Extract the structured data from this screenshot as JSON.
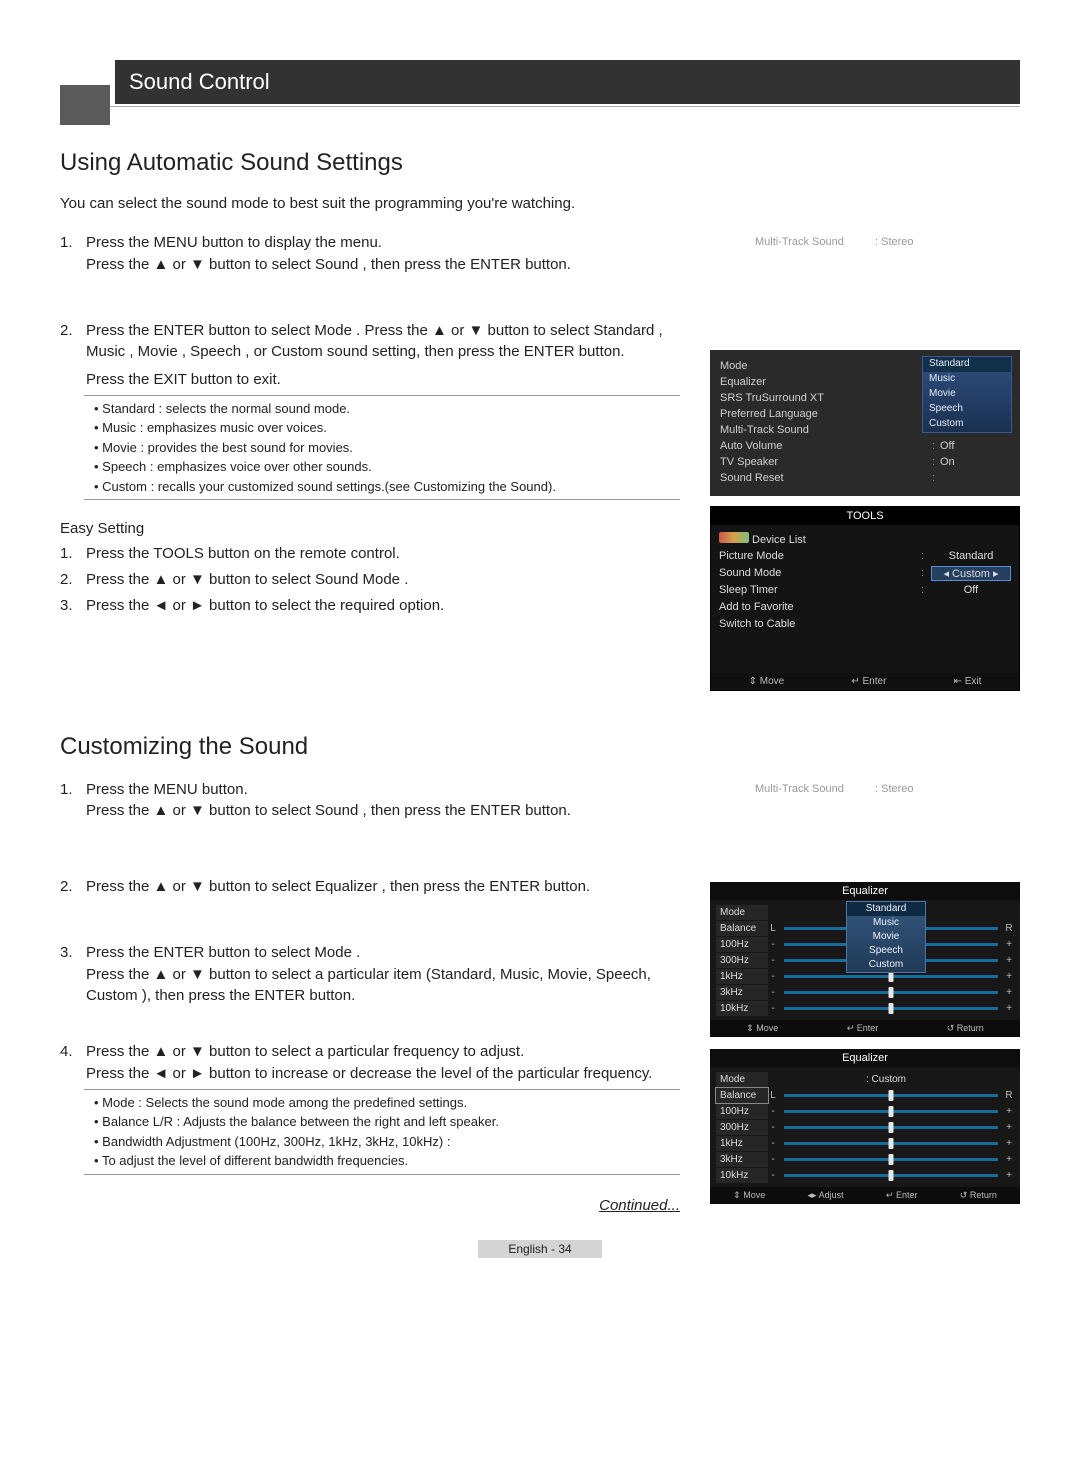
{
  "titlebar": "Sound Control",
  "section1": {
    "heading": "Using Automatic Sound Settings",
    "intro": "You can select the sound mode to best suit the programming you're watching.",
    "step1a": "Press the MENU button to display the menu.",
    "step1b": "Press the ▲ or ▼ button to select Sound , then press the ENTER    button.",
    "step2a": "Press the ENTER    button to select Mode . Press the ▲ or ▼ button to select Standard , Music , Movie , Speech , or Custom  sound setting, then press the ENTER    button.",
    "step2b": "Press the EXIT button to exit.",
    "bullets": [
      "Standard  : selects the normal sound mode.",
      "Music  : emphasizes music over voices.",
      "Movie  : provides the best sound for movies.",
      "Speech  : emphasizes voice over other sounds.",
      "Custom  : recalls your customized sound settings.(see Customizing the Sound)."
    ],
    "easy_title": "Easy Setting",
    "easy1": "Press the TOOLS button on the remote control.",
    "easy2": "Press the ▲ or ▼ button to select Sound Mode .",
    "easy3": "Press the ◄ or ► button to select the required option."
  },
  "section2": {
    "heading": "Customizing the Sound",
    "s1a": "Press the MENU button.",
    "s1b": "Press the ▲ or ▼ button to select Sound , then press the ENTER    button.",
    "s2": "Press the ▲ or ▼ button to select Equalizer , then press the ENTER    button.",
    "s3a": "Press the ENTER    button to select Mode .",
    "s3b": "Press the ▲ or ▼ button to select a particular item (Standard, Music, Movie, Speech, Custom ), then press the ENTER    button.",
    "s4a": "Press the ▲ or ▼ button to select a particular frequency to adjust.",
    "s4b": "Press the ◄ or ► button to increase or decrease the level of the particular frequency.",
    "bullets": [
      "Mode : Selects the sound mode among the predefined settings.",
      "Balance L/R : Adjusts the balance between the right and left speaker.",
      "Bandwidth Adjustment (100Hz, 300Hz, 1kHz, 3kHz, 10kHz) :",
      "   To adjust the level of different bandwidth frequencies."
    ]
  },
  "continued": "Continued...",
  "footer": "English - 34",
  "mts": {
    "label": "Multi-Track Sound",
    "value": ": Stereo"
  },
  "osd_sound": {
    "rows": [
      {
        "label": "Mode",
        "value": ""
      },
      {
        "label": "Equalizer",
        "value": ""
      },
      {
        "label": "SRS TruSurround XT",
        "value": ""
      },
      {
        "label": "Preferred Language",
        "value": ""
      },
      {
        "label": "Multi-Track Sound",
        "value": ""
      },
      {
        "label": "Auto Volume",
        "value": "Off"
      },
      {
        "label": "TV Speaker",
        "value": "On"
      },
      {
        "label": "Sound Reset",
        "value": ""
      }
    ],
    "options": [
      "Standard",
      "Music",
      "Movie",
      "Speech",
      "Custom"
    ]
  },
  "tools_panel": {
    "title": "TOOLS",
    "rows": [
      {
        "label": "Device List",
        "value": "",
        "ml": true
      },
      {
        "label": "Picture Mode",
        "value": "Standard"
      },
      {
        "label": "Sound Mode",
        "value": "Custom",
        "sel": true
      },
      {
        "label": "Sleep Timer",
        "value": "Off"
      },
      {
        "label": "Add to Favorite",
        "value": ""
      },
      {
        "label": "Switch to Cable",
        "value": ""
      }
    ],
    "footer": [
      "⇕ Move",
      "↵ Enter",
      "⇤ Exit"
    ]
  },
  "eq_panel1": {
    "title": "Equalizer",
    "mode_value": "Standard",
    "rows": [
      {
        "label": "Mode",
        "mode": true
      },
      {
        "label": "Balance",
        "l": "L",
        "r": "R"
      },
      {
        "label": "100Hz",
        "l": "-",
        "r": "+"
      },
      {
        "label": "300Hz",
        "l": "-",
        "r": "+"
      },
      {
        "label": "1kHz",
        "l": "-",
        "r": "+"
      },
      {
        "label": "3kHz",
        "l": "-",
        "r": "+"
      },
      {
        "label": "10kHz",
        "l": "-",
        "r": "+"
      }
    ],
    "dropdown": [
      "Standard",
      "Music",
      "Movie",
      "Speech",
      "Custom"
    ],
    "footer": [
      "⇕ Move",
      "↵ Enter",
      "↺ Return"
    ]
  },
  "eq_panel2": {
    "title": "Equalizer",
    "mode_value": ": Custom",
    "rows": [
      {
        "label": "Mode",
        "mode": true
      },
      {
        "label": "Balance",
        "l": "L",
        "r": "R",
        "hl": true
      },
      {
        "label": "100Hz",
        "l": "-",
        "r": "+"
      },
      {
        "label": "300Hz",
        "l": "-",
        "r": "+"
      },
      {
        "label": "1kHz",
        "l": "-",
        "r": "+"
      },
      {
        "label": "3kHz",
        "l": "-",
        "r": "+"
      },
      {
        "label": "10kHz",
        "l": "-",
        "r": "+"
      }
    ],
    "footer": [
      "⇕ Move",
      "◂▸ Adjust",
      "↵ Enter",
      "↺ Return"
    ]
  }
}
